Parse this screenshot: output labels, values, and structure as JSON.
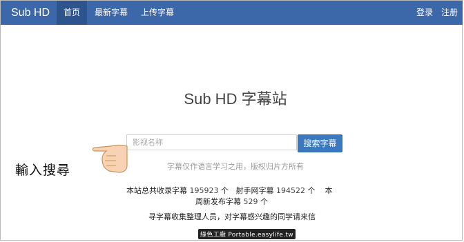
{
  "navbar": {
    "brand": "Sub HD",
    "items": [
      {
        "label": "首页",
        "active": true
      },
      {
        "label": "最新字幕",
        "active": false
      },
      {
        "label": "上传字幕",
        "active": false
      }
    ],
    "login": "登录",
    "register": "注册"
  },
  "main": {
    "title": "Sub HD 字幕站",
    "search_placeholder": "影视名称",
    "search_button": "搜索字幕",
    "tagline": "字幕仅作语言学习之用，版权归片方所有",
    "stats_line1_prefix": "本站总共收录字幕",
    "total_count": "195923",
    "unit1": "个",
    "shooter_prefix": "射手网字幕",
    "shooter_count": "194522",
    "unit2": "个",
    "week_prefix": "本",
    "stats_line2_prefix": "周新发布字幕",
    "week_count": "529",
    "unit3": "个",
    "recruit": "寻字幕收集整理人员，对字幕感兴趣的同学请来信"
  },
  "annotation": "輸入搜尋",
  "watermark": "綠色工廠 Portable.easylife.tw",
  "colors": {
    "navbar": "#3c67a8",
    "navbar_active": "#2e548d",
    "button": "#3a78c0"
  }
}
